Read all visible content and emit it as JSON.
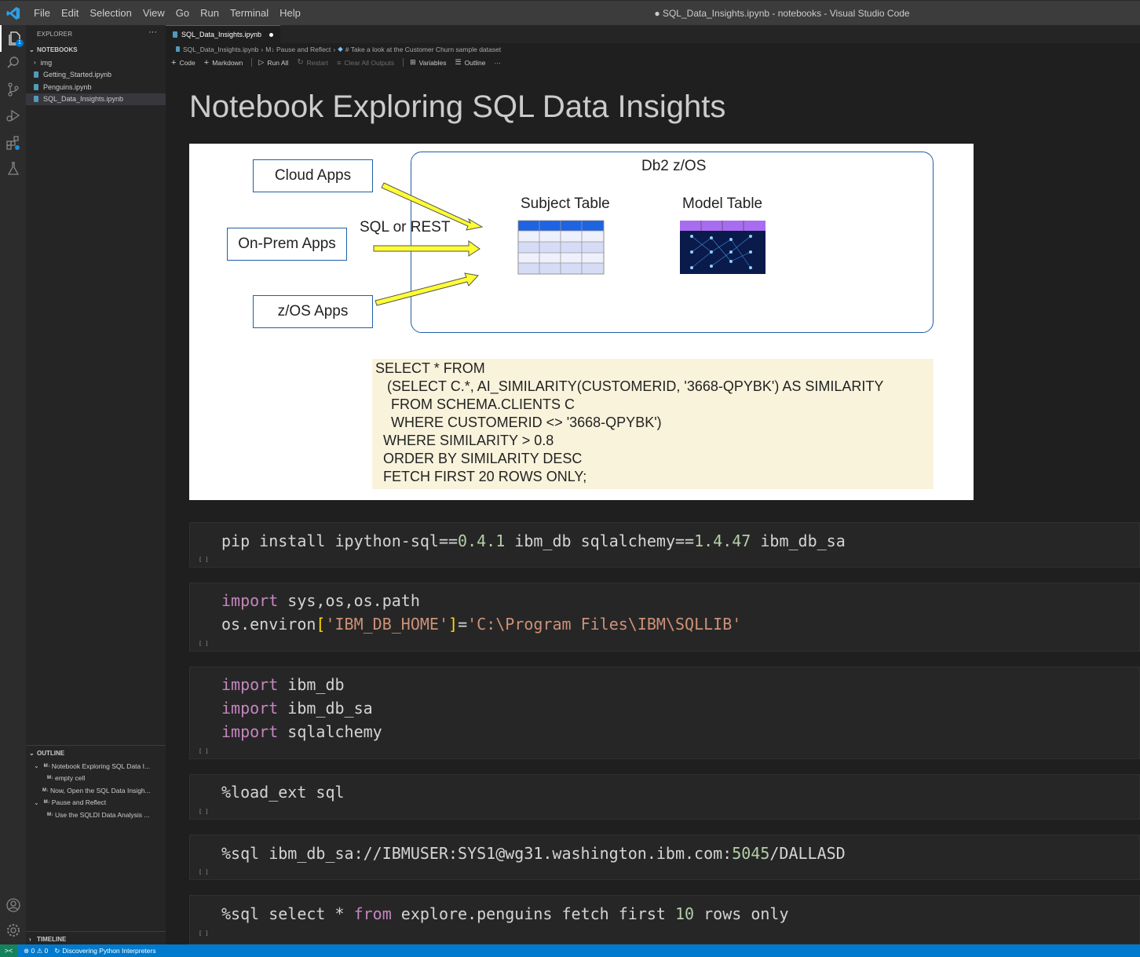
{
  "window": {
    "title": "● SQL_Data_Insights.ipynb - notebooks - Visual Studio Code",
    "menu": [
      "File",
      "Edit",
      "Selection",
      "View",
      "Go",
      "Run",
      "Terminal",
      "Help"
    ]
  },
  "activity_bar": {
    "explorer_badge": "1",
    "icons": [
      "files-icon",
      "search-icon",
      "source-control-icon",
      "run-debug-icon",
      "extensions-icon",
      "testing-icon",
      "account-icon",
      "settings-gear-icon"
    ]
  },
  "sidebar": {
    "header": "EXPLORER",
    "more": "···",
    "notebooks_section": "NOTEBOOKS",
    "tree": [
      {
        "label": "img",
        "type": "folder"
      },
      {
        "label": "Getting_Started.ipynb",
        "type": "file"
      },
      {
        "label": "Penguins.ipynb",
        "type": "file"
      },
      {
        "label": "SQL_Data_Insights.ipynb",
        "type": "file",
        "selected": true
      }
    ],
    "outline_section": "OUTLINE",
    "outline": [
      {
        "label": "Notebook Exploring SQL Data I...",
        "badge": "M↓",
        "expandable": true
      },
      {
        "label": "empty cell",
        "badge": "M↓",
        "expandable": false
      },
      {
        "label": "Now, Open the SQL Data Insigh...",
        "badge": "M↓",
        "expandable": false
      },
      {
        "label": "Pause and Reflect",
        "badge": "M↓",
        "expandable": true
      },
      {
        "label": "Use the SQLDI Data Analysis ...",
        "badge": "M↓",
        "expandable": false
      }
    ],
    "timeline_section": "TIMELINE"
  },
  "editor": {
    "tab": {
      "label": "SQL_Data_Insights.ipynb"
    },
    "breadcrumbs": [
      "SQL_Data_Insights.ipynb",
      "M↓ Pause and Reflect",
      "# Take a look at the Customer Churn sample dataset"
    ],
    "toolbar": {
      "code": "Code",
      "markdown": "Markdown",
      "run_all": "Run All",
      "restart": "Restart",
      "clear_outputs": "Clear All Outputs",
      "variables": "Variables",
      "outline": "Outline",
      "more": "···"
    },
    "notebook_title": "Notebook Exploring SQL Data Insights",
    "diagram": {
      "cloud_apps": "Cloud Apps",
      "onprem_apps": "On-Prem Apps",
      "zos_apps": "z/OS Apps",
      "sql_or_rest": "SQL or REST",
      "db2": "Db2 z/OS",
      "subject_table": "Subject Table",
      "model_table": "Model Table",
      "sql_lines": [
        "SELECT * FROM",
        "   (SELECT C.*, AI_SIMILARITY(CUSTOMERID, '3668-QPYBK') AS SIMILARITY",
        "    FROM SCHEMA.CLIENTS C",
        "    WHERE CUSTOMERID <> '3668-QPYBK')",
        "  WHERE SIMILARITY > 0.8",
        "  ORDER BY SIMILARITY DESC",
        "  FETCH FIRST 20 ROWS ONLY;"
      ]
    },
    "exec_label": "[ ]",
    "cells": [
      {
        "lines": [
          [
            [
              "pip install ipython-sql==",
              "plain"
            ],
            [
              "0.4.1",
              "num"
            ],
            [
              " ibm_db sqlalchemy==",
              "plain"
            ],
            [
              "1.4.47",
              "num"
            ],
            [
              " ibm_db_sa",
              "plain"
            ]
          ]
        ]
      },
      {
        "lines": [
          [
            [
              "import",
              "kw"
            ],
            [
              " sys,os,os.path",
              "plain"
            ]
          ],
          [
            [
              "os.environ",
              "plain"
            ],
            [
              "[",
              "brk"
            ],
            [
              "'IBM_DB_HOME'",
              "str"
            ],
            [
              "]",
              "brk"
            ],
            [
              "=",
              "plain"
            ],
            [
              "'C:\\Program Files\\IBM\\SQLLIB'",
              "str"
            ]
          ]
        ]
      },
      {
        "lines": [
          [
            [
              "import",
              "kw"
            ],
            [
              " ibm_db",
              "plain"
            ]
          ],
          [
            [
              "import",
              "kw"
            ],
            [
              " ibm_db_sa",
              "plain"
            ]
          ],
          [
            [
              "import",
              "kw"
            ],
            [
              " sqlalchemy",
              "plain"
            ]
          ]
        ]
      },
      {
        "lines": [
          [
            [
              "%load_ext sql",
              "plain"
            ]
          ]
        ]
      },
      {
        "lines": [
          [
            [
              "%sql ibm_db_sa://IBMUSER:SYS1@wg31.washington.ibm.com:",
              "plain"
            ],
            [
              "5045",
              "num"
            ],
            [
              "/DALLASD",
              "plain"
            ]
          ]
        ]
      },
      {
        "lines": [
          [
            [
              "%sql select * ",
              "plain"
            ],
            [
              "from",
              "kw"
            ],
            [
              " explore.penguins fetch first ",
              "plain"
            ],
            [
              "10",
              "num"
            ],
            [
              " rows only",
              "plain"
            ]
          ]
        ]
      }
    ]
  },
  "statusbar": {
    "remote": "><",
    "problems": "⊗ 0 ⚠ 0",
    "task": "Discovering Python Interpreters"
  }
}
